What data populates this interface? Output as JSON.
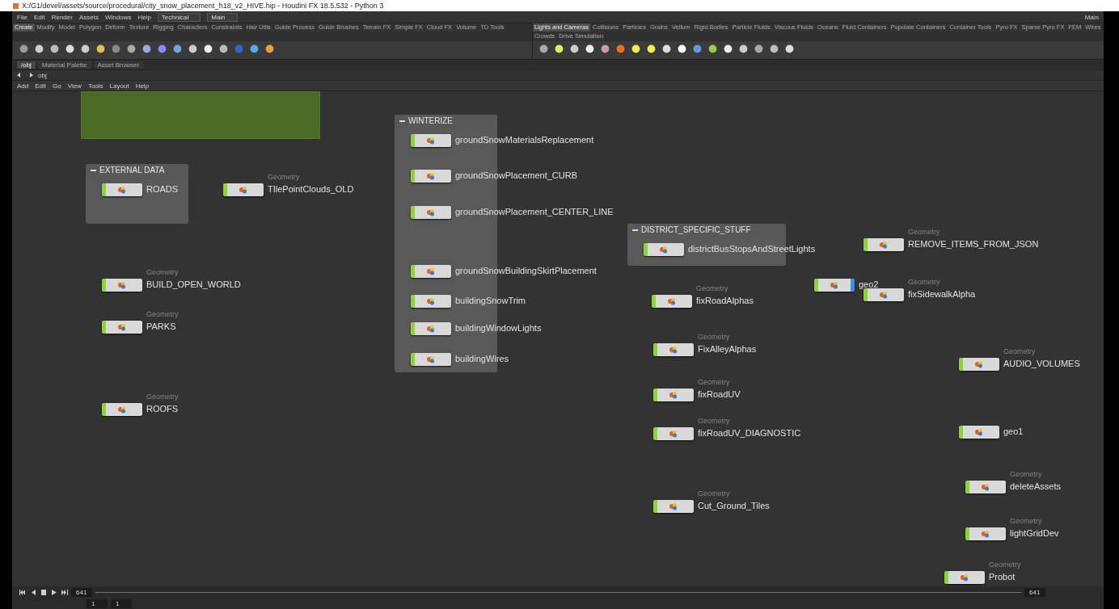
{
  "window": {
    "title": "X:/G1/devel/assets/source/procedural/city_snow_placement_h18_v2_HIVE.hip - Houdini FX 18.5.532 - Python 3"
  },
  "menu_bar": {
    "items": [
      "File",
      "Edit",
      "Render",
      "Assets",
      "Windows",
      "Help"
    ],
    "desktop": "Technical",
    "desktop_right": "Main",
    "main_tab": "Main"
  },
  "shelf_left": {
    "tabs": [
      {
        "label": "Create",
        "selected": true
      },
      {
        "label": "Modify",
        "selected": false
      },
      {
        "label": "Model",
        "selected": false
      },
      {
        "label": "Polygon",
        "selected": false
      },
      {
        "label": "Deform",
        "selected": false
      },
      {
        "label": "Texture",
        "selected": false
      },
      {
        "label": "Rigging",
        "selected": false
      },
      {
        "label": "Characters",
        "selected": false
      },
      {
        "label": "Constraints",
        "selected": false
      },
      {
        "label": "Hair Utils",
        "selected": false
      },
      {
        "label": "Guide Process",
        "selected": false
      },
      {
        "label": "Guide Brushes",
        "selected": false
      },
      {
        "label": "Terrain FX",
        "selected": false
      },
      {
        "label": "Simple FX",
        "selected": false
      },
      {
        "label": "Cloud FX",
        "selected": false
      },
      {
        "label": "Volume",
        "selected": false
      },
      {
        "label": "TD Tools",
        "selected": false
      }
    ]
  },
  "shelf_right": {
    "tabs": [
      {
        "label": "Lights and Cameras",
        "selected": true
      },
      {
        "label": "Collisions",
        "selected": false
      },
      {
        "label": "Particles",
        "selected": false
      },
      {
        "label": "Grains",
        "selected": false
      },
      {
        "label": "Vellum",
        "selected": false
      },
      {
        "label": "Rigid Bodies",
        "selected": false
      },
      {
        "label": "Particle Fluids",
        "selected": false
      },
      {
        "label": "Viscous Fluids",
        "selected": false
      },
      {
        "label": "Oceans",
        "selected": false
      },
      {
        "label": "Fluid Containers",
        "selected": false
      },
      {
        "label": "Populate Containers",
        "selected": false
      },
      {
        "label": "Container Tools",
        "selected": false
      },
      {
        "label": "Pyro FX",
        "selected": false
      },
      {
        "label": "Sparse Pyro FX",
        "selected": false
      },
      {
        "label": "FEM",
        "selected": false
      },
      {
        "label": "Wires",
        "selected": false
      },
      {
        "label": "Crowds",
        "selected": false
      },
      {
        "label": "Drive Simulation",
        "selected": false
      }
    ]
  },
  "pane_tabs": [
    {
      "label": "/obj",
      "selected": true
    },
    {
      "label": "Material Palette",
      "selected": false
    },
    {
      "label": "Asset Browser",
      "selected": false
    }
  ],
  "path": "obj",
  "network_menu": [
    "Add",
    "Edit",
    "Go",
    "View",
    "Tools",
    "Layout",
    "Help"
  ],
  "network_boxes": [
    {
      "title": "EXTERNAL DATA"
    },
    {
      "title": "WINTERIZE"
    },
    {
      "title": "DISTRICT_SPECIFIC_STUFF"
    }
  ],
  "nodes": [
    {
      "name": "ROADS",
      "display": false
    },
    {
      "name": "TIlePointClouds_OLD",
      "type": "Geometry",
      "display": false
    },
    {
      "name": "BUILD_OPEN_WORLD",
      "type": "Geometry",
      "display": false
    },
    {
      "name": "PARKS",
      "type": "Geometry",
      "display": false
    },
    {
      "name": "ROOFS",
      "type": "Geometry",
      "display": false
    },
    {
      "name": "groundSnowMaterialsReplacement",
      "display": false
    },
    {
      "name": "groundSnowPlacement_CURB",
      "display": false
    },
    {
      "name": "groundSnowPlacement_CENTER_LINE",
      "display": false
    },
    {
      "name": "groundSnowBuildingSkirtPlacement",
      "display": false
    },
    {
      "name": "buildingSnowTrim",
      "display": false
    },
    {
      "name": "buildingWindowLights",
      "display": false
    },
    {
      "name": "buildingWires",
      "display": false
    },
    {
      "name": "districtBusStopsAndStreetLights",
      "display": false
    },
    {
      "name": "REMOVE_ITEMS_FROM_JSON",
      "type": "Geometry",
      "display": false
    },
    {
      "name": "geo2",
      "display": true
    },
    {
      "name": "fixSidewalkAlpha",
      "type": "Geometry",
      "display": false
    },
    {
      "name": "fixRoadAlphas",
      "type": "Geometry",
      "display": false
    },
    {
      "name": "FixAlleyAlphas",
      "type": "Geometry",
      "display": false
    },
    {
      "name": "fixRoadUV",
      "type": "Geometry",
      "display": false
    },
    {
      "name": "fixRoadUV_DIAGNOSTIC",
      "type": "Geometry",
      "display": false
    },
    {
      "name": "Cut_Ground_Tiles",
      "type": "Geometry",
      "display": false
    },
    {
      "name": "AUDIO_VOLUMES",
      "type": "Geometry",
      "display": false
    },
    {
      "name": "geo1",
      "display": false
    },
    {
      "name": "deleteAssets",
      "type": "Geometry",
      "display": false
    },
    {
      "name": "lightGridDev",
      "type": "Geometry",
      "display": false
    },
    {
      "name": "Probot",
      "type": "Geometry",
      "display": false
    }
  ],
  "playbar": {
    "frame": "641",
    "end_frame": "641",
    "start": "1",
    "range_start": "1"
  }
}
